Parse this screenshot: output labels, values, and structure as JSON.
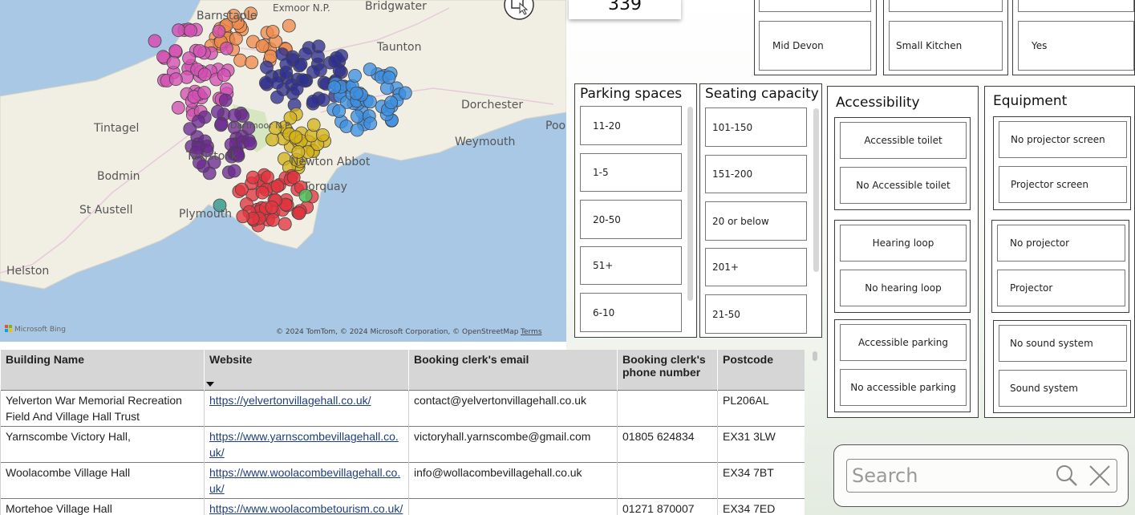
{
  "map": {
    "labels": [
      "Exmoor N.P.",
      "Bridgwater",
      "Barnstaple",
      "Taunton",
      "Dorchester",
      "Weymouth",
      "Tintagel",
      "Bodmin",
      "St Austell",
      "Helston",
      "Dartmoor N.P.",
      "Tavistock",
      "Newton Abbot",
      "Torquay",
      "Plymouth",
      "Poole"
    ],
    "attribution": "© 2024 TomTom, © 2024 Microsoft Corporation, © OpenStreetMap",
    "terms": "Terms",
    "brand": "Microsoft Bing",
    "icon": "focus-mode-icon"
  },
  "card": {
    "value": "339"
  },
  "top_slicers": [
    {
      "value": "Mid Devon"
    },
    {
      "value": "Small Kitchen"
    },
    {
      "value": "Yes"
    }
  ],
  "parking": {
    "title": "Parking spaces",
    "items": [
      "11-20",
      "1-5",
      "20-50",
      "51+",
      "6-10"
    ]
  },
  "seating": {
    "title": "Seating capacity",
    "items": [
      "101-150",
      "151-200",
      "20 or below",
      "201+",
      "21-50"
    ]
  },
  "accessibility": {
    "title": "Accessibility",
    "groups": [
      [
        "Accessible toilet",
        "No Accessible toilet"
      ],
      [
        "Hearing loop",
        "No hearing loop"
      ],
      [
        "Accessible parking",
        "No accessible parking"
      ]
    ]
  },
  "equipment": {
    "title": "Equipment",
    "groups": [
      [
        "No projector screen",
        "Projector screen"
      ],
      [
        "No projector",
        "Projector"
      ],
      [
        "No sound system",
        "Sound system"
      ]
    ]
  },
  "table": {
    "headers": [
      "Building Name",
      "Website",
      "Booking clerk's email",
      "Booking clerk's phone number",
      "Postcode"
    ],
    "rows": [
      [
        "Yelverton War Memorial Recreation Field And Village Hall Trust",
        "https://yelvertonvillagehall.co.uk/",
        "contact@yelvertonvillagehall.co.uk",
        "",
        "PL206AL"
      ],
      [
        "Yarnscombe Victory Hall,",
        "https://www.yarnscombevillagehall.co.uk/",
        "victoryhall.yarnscombe@gmail.com",
        "01805 624834",
        "EX31 3LW"
      ],
      [
        "Woolacombe Village Hall",
        "https://www.woolacombevillagehall.co.uk/",
        "info@wollacombevillagehall.co.uk",
        "",
        "EX34 7BT"
      ],
      [
        "Mortehoe Village Hall",
        "https://www.woolacombetourism.co.uk/directory/mortehoe-village-hall",
        "",
        "01271 870007",
        "EX34 7ED"
      ]
    ]
  },
  "search": {
    "placeholder": "Search"
  },
  "colors": {
    "sea": "#a8c8e6",
    "land": "#f2f0e6",
    "magenta": "#d44fb4",
    "orange": "#f08a4b",
    "navy": "#2f2f8f",
    "blue": "#3d8fe0",
    "purple": "#6a2a8f",
    "yellow": "#d4b21a",
    "red": "#e0343f"
  }
}
